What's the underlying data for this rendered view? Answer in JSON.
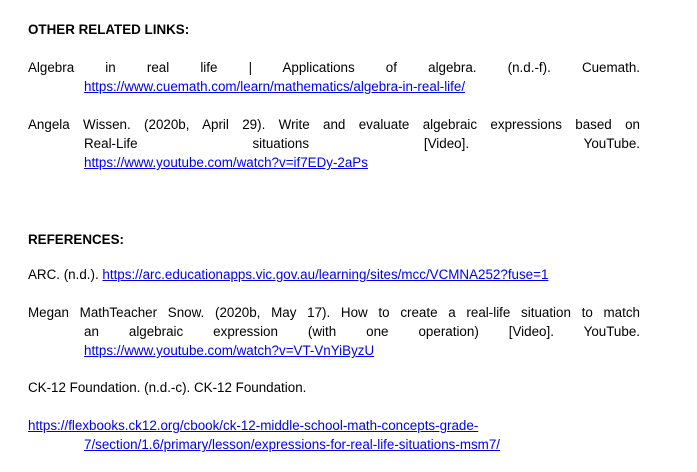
{
  "sections": {
    "other_links_heading": "OTHER RELATED LINKS:",
    "references_heading": "REFERENCES:"
  },
  "other_links": [
    {
      "line1": "Algebra in real life | Applications of algebra. (n.d.-f). Cuemath.",
      "url": "https://www.cuemath.com/learn/mathematics/algebra-in-real-life/"
    },
    {
      "line1": "Angela Wissen. (2020b, April 29). Write and evaluate algebraic expressions based on",
      "line2": "Real-Life situations [Video]. YouTube.",
      "url": "https://www.youtube.com/watch?v=if7EDy-2aPs"
    }
  ],
  "references": [
    {
      "text": "ARC. (n.d.). ",
      "url": "https://arc.educationapps.vic.gov.au/learning/sites/mcc/VCMNA252?fuse=1"
    },
    {
      "line1": "Megan MathTeacher Snow. (2020b, May 17). How to create a real-life situation to match",
      "line2": "an algebraic expression (with one operation) [Video]. YouTube.",
      "url": "https://www.youtube.com/watch?v=VT-VnYiByzU"
    },
    {
      "line1": "CK-12 Foundation. (n.d.-c). CK-12 Foundation."
    },
    {
      "url_line1": "https://flexbooks.ck12.org/cbook/ck-12-middle-school-math-concepts-grade-",
      "url_line2": "7/section/1.6/primary/lesson/expressions-for-real-life-situations-msm7/"
    }
  ]
}
